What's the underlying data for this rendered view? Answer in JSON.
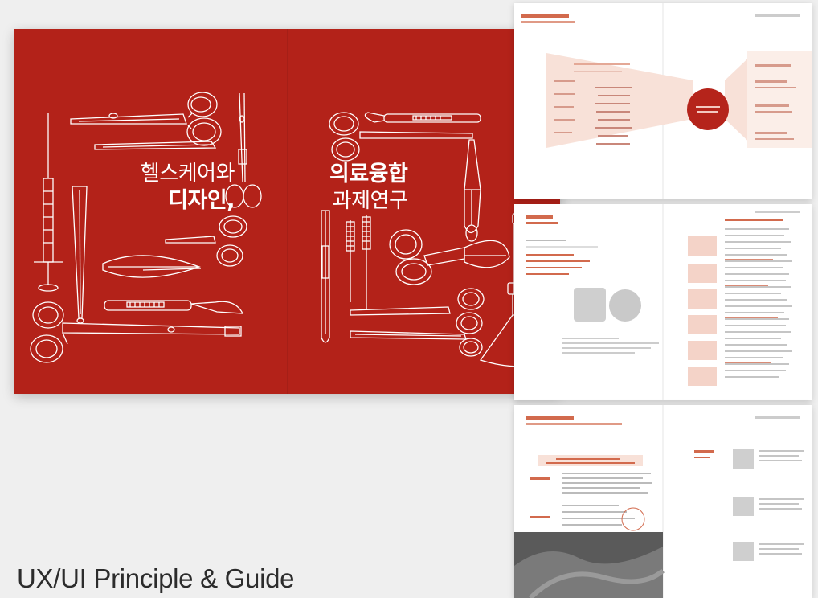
{
  "cover": {
    "title_left_line1": "헬스케어와",
    "title_left_line2": "디자인,",
    "title_right_line1": "의료융합",
    "title_right_line2": "과제연구",
    "colors": {
      "background": "#b32219",
      "line": "#ffffff"
    }
  },
  "caption": "UX/UI Principle & Guide"
}
